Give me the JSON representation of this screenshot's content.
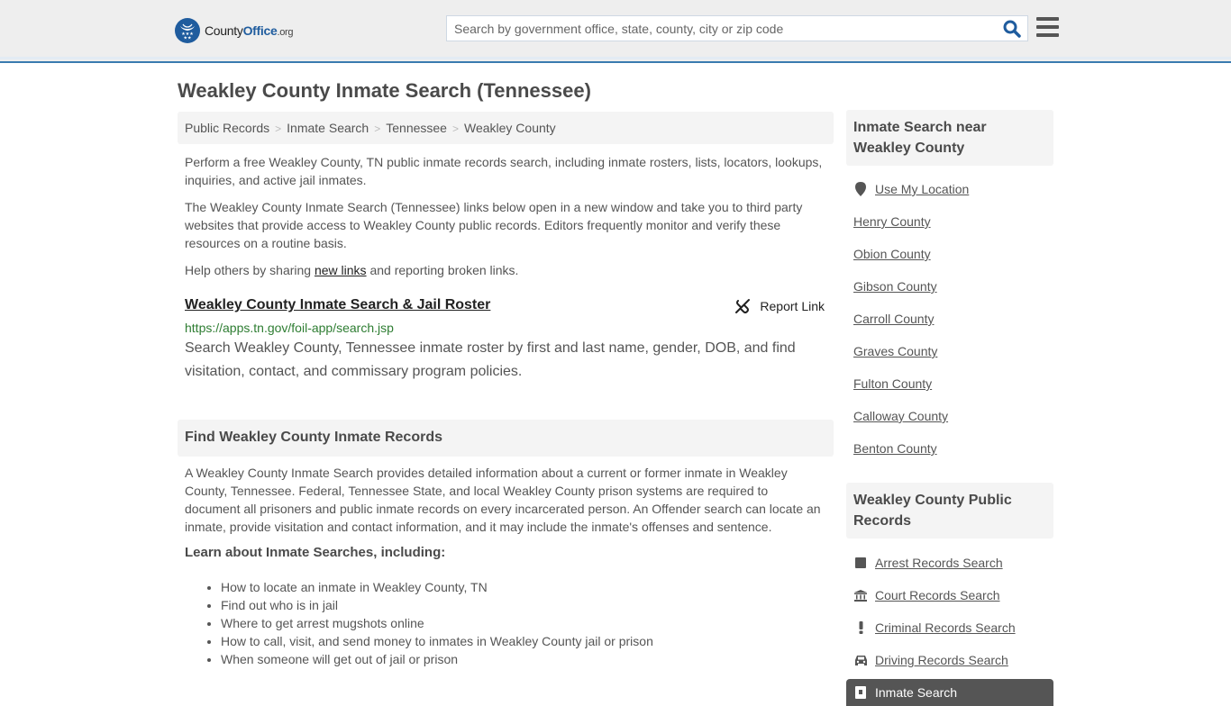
{
  "header": {
    "logo": {
      "county": "County",
      "office": "Office",
      "tld": ".org"
    },
    "search": {
      "placeholder": "Search by government office, state, county, city or zip code",
      "value": ""
    },
    "icons": {
      "search": "search-icon",
      "menu": "hamburger-menu-icon"
    }
  },
  "page": {
    "title": "Weakley County Inmate Search (Tennessee)"
  },
  "breadcrumb": [
    {
      "label": "Public Records"
    },
    {
      "label": "Inmate Search"
    },
    {
      "label": "Tennessee"
    },
    {
      "label": "Weakley County"
    }
  ],
  "intro": {
    "p1": "Perform a free Weakley County, TN public inmate records search, including inmate rosters, lists, locators, lookups, inquiries, and active jail inmates.",
    "p2": "The Weakley County Inmate Search (Tennessee) links below open in a new window and take you to third party websites that provide access to Weakley County public records. Editors frequently monitor and verify these resources on a routine basis.",
    "p3_before": "Help others by sharing ",
    "p3_link": "new links",
    "p3_after": " and reporting broken links."
  },
  "result": {
    "title": "Weakley County Inmate Search & Jail Roster",
    "report_label": "Report Link",
    "url": "https://apps.tn.gov/foil-app/search.jsp",
    "description": "Search Weakley County, Tennessee inmate roster by first and last name, gender, DOB, and find visitation, contact, and commissary program policies."
  },
  "find_section": {
    "heading": "Find Weakley County Inmate Records",
    "body": "A Weakley County Inmate Search provides detailed information about a current or former inmate in Weakley County, Tennessee. Federal, Tennessee State, and local Weakley County prison systems are required to document all prisoners and public inmate records on every incarcerated person. An Offender search can locate an inmate, provide visitation and contact information, and it may include the inmate's offenses and sentence.",
    "learn_heading": "Learn about Inmate Searches, including:",
    "learn_items": [
      "How to locate an inmate in Weakley County, TN",
      "Find out who is in jail",
      "Where to get arrest mugshots online",
      "How to call, visit, and send money to inmates in Weakley County jail or prison",
      "When someone will get out of jail or prison"
    ]
  },
  "sidebar": {
    "nearby": {
      "heading": "Inmate Search near Weakley County",
      "use_location": "Use My Location",
      "counties": [
        "Henry County",
        "Obion County",
        "Gibson County",
        "Carroll County",
        "Graves County",
        "Fulton County",
        "Calloway County",
        "Benton County"
      ]
    },
    "records": {
      "heading": "Weakley County Public Records",
      "items": [
        {
          "label": "Arrest Records Search",
          "icon": "square-icon"
        },
        {
          "label": "Court Records Search",
          "icon": "courthouse-icon"
        },
        {
          "label": "Criminal Records Search",
          "icon": "exclamation-icon"
        },
        {
          "label": "Driving Records Search",
          "icon": "car-icon"
        }
      ],
      "active": {
        "label": "Inmate Search",
        "icon": "jail-door-icon"
      }
    }
  }
}
